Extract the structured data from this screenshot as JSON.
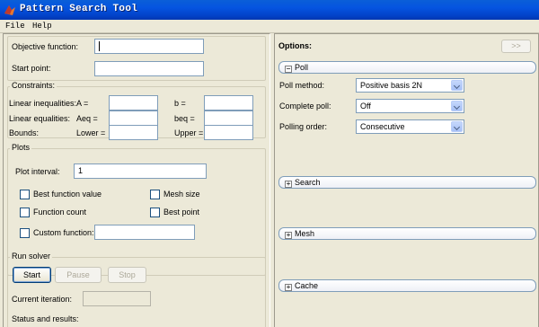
{
  "window": {
    "title": "Pattern Search Tool"
  },
  "menu": {
    "file": "File",
    "help": "Help"
  },
  "problem": {
    "objective_label": "Objective function:",
    "objective_value": "",
    "start_label": "Start point:",
    "start_value": ""
  },
  "constraints": {
    "title": "Constraints:",
    "linear_ineq_label": "Linear inequalities:",
    "a_label": "A =",
    "b_label": "b =",
    "linear_eq_label": "Linear equalities:",
    "aeq_label": "Aeq =",
    "beq_label": "beq =",
    "bounds_label": "Bounds:",
    "lower_label": "Lower =",
    "upper_label": "Upper ="
  },
  "plots": {
    "title": "Plots",
    "interval_label": "Plot interval:",
    "interval_value": "1",
    "best_function_value": "Best function value",
    "mesh_size": "Mesh size",
    "function_count": "Function count",
    "best_point": "Best point",
    "custom_function": "Custom function:",
    "custom_value": ""
  },
  "run": {
    "title": "Run solver",
    "start": "Start",
    "pause": "Pause",
    "stop": "Stop",
    "current_iteration_label": "Current iteration:",
    "status_label": "Status and results:"
  },
  "options": {
    "title": "Options:",
    "collapse_btn": ">>",
    "poll": {
      "header": "Poll",
      "toggle": "−",
      "method_label": "Poll method:",
      "method_value": "Positive basis 2N",
      "complete_label": "Complete poll:",
      "complete_value": "Off",
      "order_label": "Polling order:",
      "order_value": "Consecutive"
    },
    "search": {
      "header": "Search",
      "toggle": "+"
    },
    "mesh": {
      "header": "Mesh",
      "toggle": "+"
    },
    "cache": {
      "header": "Cache",
      "toggle": "+"
    }
  }
}
